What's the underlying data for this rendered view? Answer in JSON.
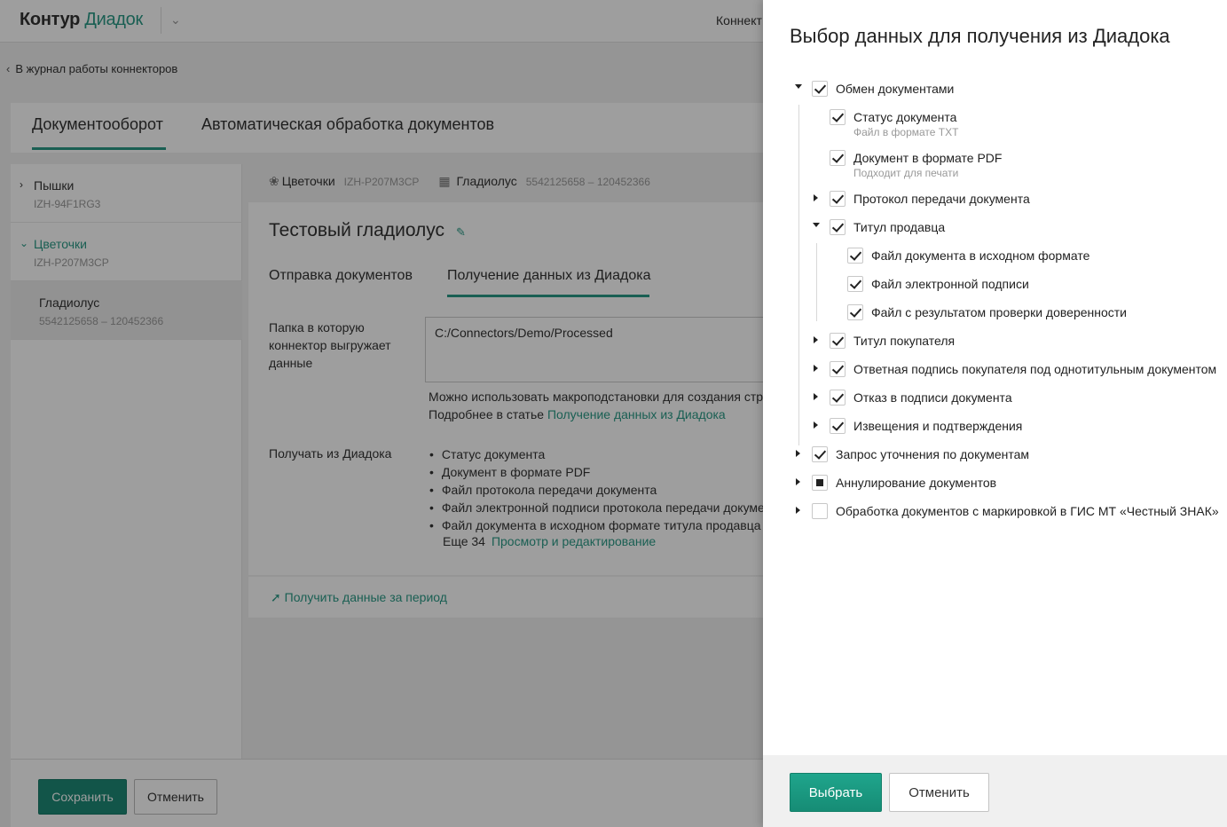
{
  "header": {
    "logo_part1": "Контур",
    "logo_part2": "Диадок",
    "right_text": "Коннект",
    "accent_color": "#2a9a86"
  },
  "back_link": "В журнал работы коннекторов",
  "main_tabs": [
    "Документооборот",
    "Автоматическая обработка документов"
  ],
  "sidebar": {
    "items": [
      {
        "name": "Пышки",
        "code": "IZH-94F1RG3"
      },
      {
        "name": "Цветочки",
        "code": "IZH-P207M3CP"
      },
      {
        "name": "Гладиолус",
        "code": "5542125658 – 120452366"
      }
    ]
  },
  "breadcrumb": {
    "org": "Цветочки",
    "org_code": "IZH-P207M3CP",
    "box": "Гладиолус",
    "box_code": "5542125658 – 120452366"
  },
  "content": {
    "title": "Тестовый гладиолус",
    "subtabs": [
      "Отправка документов",
      "Получение данных из Диадока"
    ],
    "folder_label": "Папка в которую коннектор выгружает данные",
    "folder_value": "C:/Connectors/Demo/Processed",
    "hint_line1": "Можно использовать макроподстановки для создания стр",
    "hint_line2_prefix": "Подробнее в статье",
    "hint_link": "Получение данных из Диадока",
    "get_label": "Получать из Диадока",
    "get_items": [
      "Статус документа",
      "Документ в формате PDF",
      "Файл протокола передачи документа",
      "Файл электронной подписи протокола передачи докуме",
      "Файл документа в исходном формате титула продавца"
    ],
    "more_text": "Еще 34",
    "more_link": "Просмотр и редактирование",
    "period_link": "Получить данные за период"
  },
  "footer": {
    "save": "Сохранить",
    "cancel": "Отменить"
  },
  "dialog": {
    "title": "Выбор данных для получения из Диадока",
    "tree": [
      {
        "label": "Обмен документами",
        "state": "checked",
        "expander": "down",
        "level": 0
      },
      {
        "label": "Статус документа",
        "sub": "Файл в формате TXT",
        "state": "checked",
        "expander": "none",
        "level": 1
      },
      {
        "label": "Документ в формате PDF",
        "sub": "Подходит для печати",
        "state": "checked",
        "expander": "none",
        "level": 1
      },
      {
        "label": "Протокол передачи документа",
        "state": "checked",
        "expander": "right",
        "level": 1
      },
      {
        "label": "Титул продавца",
        "state": "checked",
        "expander": "down",
        "level": 1
      },
      {
        "label": "Файл документа в исходном формате",
        "state": "checked",
        "expander": "none",
        "level": 2
      },
      {
        "label": "Файл электронной подписи",
        "state": "checked",
        "expander": "none",
        "level": 2
      },
      {
        "label": "Файл с результатом проверки доверенности",
        "state": "checked",
        "expander": "none",
        "level": 2
      },
      {
        "label": "Титул покупателя",
        "state": "checked",
        "expander": "right",
        "level": 1
      },
      {
        "label": "Ответная подпись покупателя под однотитульным документом",
        "state": "checked",
        "expander": "right",
        "level": 1
      },
      {
        "label": "Отказ в подписи документа",
        "state": "checked",
        "expander": "right",
        "level": 1
      },
      {
        "label": "Извещения и подтверждения",
        "state": "checked",
        "expander": "right",
        "level": 1
      },
      {
        "label": "Запрос уточнения по документам",
        "state": "checked",
        "expander": "right",
        "level": 0
      },
      {
        "label": "Аннулирование документов",
        "state": "partial",
        "expander": "right",
        "level": 0
      },
      {
        "label": "Обработка документов с маркировкой в ГИС МТ «Честный ЗНАК»",
        "state": "unchecked",
        "expander": "right",
        "level": 0
      }
    ],
    "select_button": "Выбрать",
    "cancel_button": "Отменить"
  }
}
